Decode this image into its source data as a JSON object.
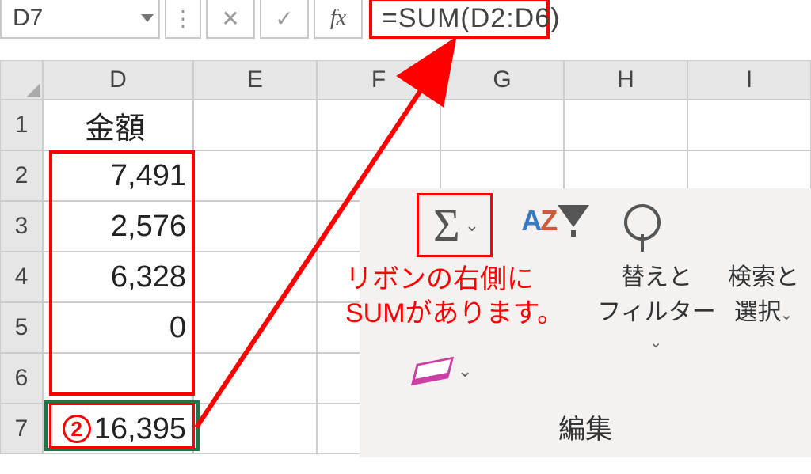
{
  "formula_bar": {
    "name_box": "D7",
    "fx_label": "fx",
    "formula": "=SUM(D2:D6)"
  },
  "columns": [
    "D",
    "E",
    "F",
    "G",
    "H",
    "I"
  ],
  "rows": [
    {
      "num": "1",
      "D": "金額"
    },
    {
      "num": "2",
      "D": "7,491"
    },
    {
      "num": "3",
      "D": "2,576"
    },
    {
      "num": "4",
      "D": "6,328"
    },
    {
      "num": "5",
      "D": "0"
    },
    {
      "num": "6",
      "D": ""
    },
    {
      "num": "7",
      "D": "16,395",
      "badge": "2"
    }
  ],
  "annotation": {
    "line1": "リボンの右側に",
    "line2": "SUMがあります。"
  },
  "ribbon": {
    "autosum_sigma": "Σ",
    "sort_az_a": "A",
    "sort_az_z": "Z",
    "sort_label_1": "替えと",
    "sort_label_2": "フィルター",
    "find_label_1": "検索と",
    "find_label_2": "選択",
    "section": "編集"
  }
}
